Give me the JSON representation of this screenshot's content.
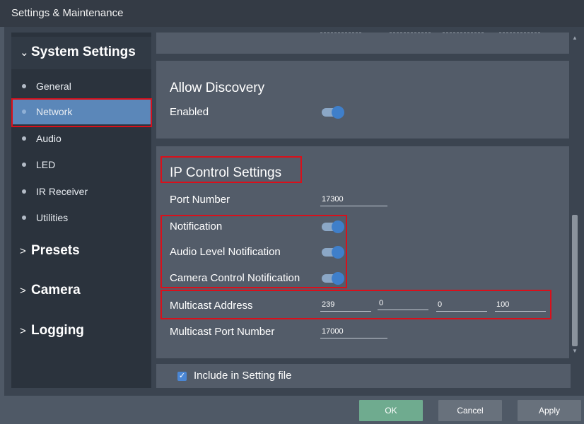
{
  "window": {
    "title": "Settings & Maintenance"
  },
  "sidebar": {
    "system_settings": {
      "chevron": "⌄",
      "label": "System Settings"
    },
    "items": [
      {
        "label": "General"
      },
      {
        "label": "Network"
      },
      {
        "label": "Audio"
      },
      {
        "label": "LED"
      },
      {
        "label": "IR Receiver"
      },
      {
        "label": "Utilities"
      }
    ],
    "active_item": "Network",
    "presets": {
      "chevron": ">",
      "label": "Presets"
    },
    "camera": {
      "chevron": ">",
      "label": "Camera"
    },
    "logging": {
      "chevron": ">",
      "label": "Logging"
    }
  },
  "allow_discovery": {
    "title": "Allow Discovery",
    "enabled_label": "Enabled",
    "enabled": true
  },
  "ip_control": {
    "title": "IP Control Settings",
    "port_number_label": "Port Number",
    "port_number": "17300",
    "notification_label": "Notification",
    "notification": true,
    "audio_level_label": "Audio Level Notification",
    "audio_level": true,
    "camera_control_label": "Camera Control Notification",
    "camera_control": true,
    "multicast_address_label": "Multicast Address",
    "multicast_address": [
      "239",
      "0",
      "0",
      "100"
    ],
    "multicast_port_label": "Multicast Port Number",
    "multicast_port": "17000"
  },
  "include": {
    "label": "Include in Setting file",
    "checked": true
  },
  "footer": {
    "ok": "OK",
    "cancel": "Cancel",
    "apply": "Apply"
  },
  "colors": {
    "accent": "#5b87b9",
    "toggle_on": "#3f7fca",
    "ok_button": "#6fab8f",
    "highlight": "#d9101b"
  }
}
